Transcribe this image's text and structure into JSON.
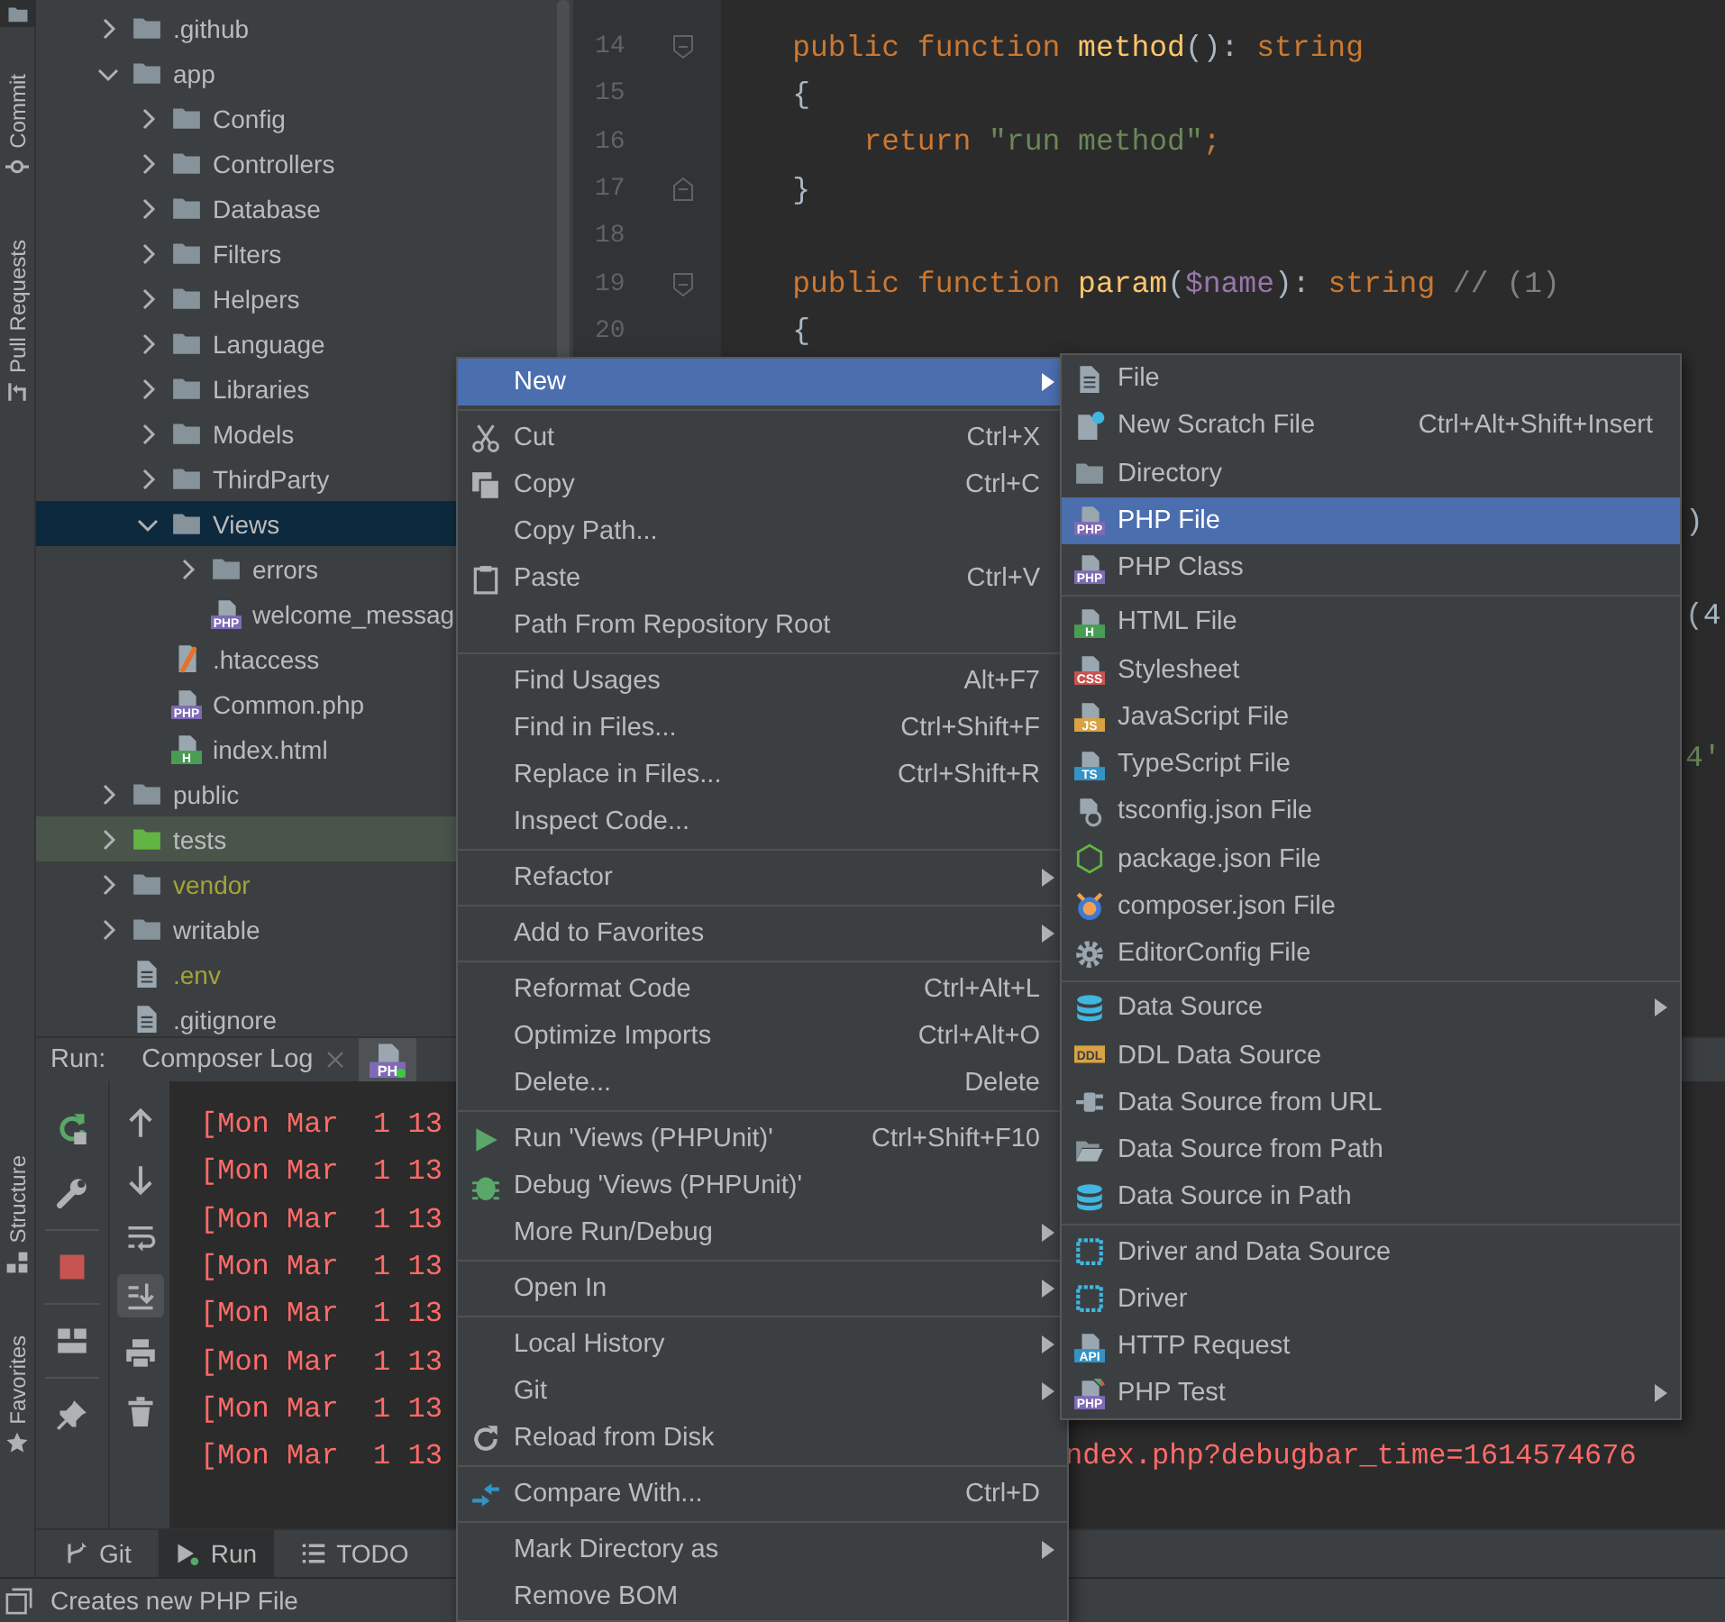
{
  "side_strip": {
    "project_button": {
      "selected": true
    },
    "top": [
      {
        "label": "Commit"
      },
      {
        "label": "Pull Requests"
      }
    ],
    "bottom": [
      {
        "label": "Structure"
      },
      {
        "label": "Favorites"
      }
    ]
  },
  "tree": [
    {
      "label": ".github",
      "kind": "folder",
      "expanded": false,
      "selected": false,
      "ignored": false
    },
    {
      "label": "app",
      "kind": "folder",
      "expanded": true,
      "selected": false,
      "ignored": false,
      "children": [
        {
          "label": "Config",
          "kind": "folder",
          "expanded": false,
          "selected": false,
          "ignored": false
        },
        {
          "label": "Controllers",
          "kind": "folder",
          "expanded": false,
          "selected": false,
          "ignored": false
        },
        {
          "label": "Database",
          "kind": "folder",
          "expanded": false,
          "selected": false,
          "ignored": false
        },
        {
          "label": "Filters",
          "kind": "folder",
          "expanded": false,
          "selected": false,
          "ignored": false
        },
        {
          "label": "Helpers",
          "kind": "folder",
          "expanded": false,
          "selected": false,
          "ignored": false
        },
        {
          "label": "Language",
          "kind": "folder",
          "expanded": false,
          "selected": false,
          "ignored": false
        },
        {
          "label": "Libraries",
          "kind": "folder",
          "expanded": false,
          "selected": false,
          "ignored": false
        },
        {
          "label": "Models",
          "kind": "folder",
          "expanded": false,
          "selected": false,
          "ignored": false
        },
        {
          "label": "ThirdParty",
          "kind": "folder",
          "expanded": false,
          "selected": false,
          "ignored": false
        },
        {
          "label": "Views",
          "kind": "folder",
          "expanded": true,
          "selected": true,
          "ignored": false,
          "children": [
            {
              "label": "errors",
              "kind": "folder",
              "expanded": false,
              "selected": false,
              "ignored": false
            },
            {
              "label": "welcome_messag",
              "kind": "php-file",
              "badge": "PHP",
              "selected": false,
              "ignored": false
            }
          ]
        },
        {
          "label": ".htaccess",
          "kind": "htaccess-file",
          "selected": false,
          "ignored": false
        },
        {
          "label": "Common.php",
          "kind": "php-file",
          "badge": "PHP",
          "selected": false,
          "ignored": false
        },
        {
          "label": "index.html",
          "kind": "html-file",
          "badge": "H",
          "selected": false,
          "ignored": false
        }
      ]
    },
    {
      "label": "public",
      "kind": "folder",
      "expanded": false,
      "selected": false,
      "ignored": false
    },
    {
      "label": "tests",
      "kind": "test-folder",
      "expanded": false,
      "selected": false,
      "ignored": false
    },
    {
      "label": "vendor",
      "kind": "folder",
      "expanded": false,
      "selected": false,
      "ignored": true
    },
    {
      "label": "writable",
      "kind": "folder",
      "expanded": false,
      "selected": false,
      "ignored": false
    },
    {
      "label": ".env",
      "kind": "file",
      "selected": false,
      "ignored": true
    },
    {
      "label": ".gitignore",
      "kind": "file",
      "selected": false,
      "ignored": false
    }
  ],
  "editor": {
    "lines": [
      {
        "number": "14",
        "kind": "block-start",
        "tokens": [
          {
            "text": "    public function ",
            "kind": "keyword"
          },
          {
            "text": "method",
            "kind": "function"
          },
          {
            "text": "(): ",
            "kind": "plain"
          },
          {
            "text": "string",
            "kind": "keyword"
          }
        ]
      },
      {
        "number": "15",
        "kind": "code",
        "tokens": [
          {
            "text": "    {",
            "kind": "plain"
          }
        ]
      },
      {
        "number": "16",
        "kind": "code",
        "tokens": [
          {
            "text": "        return ",
            "kind": "keyword"
          },
          {
            "text": "\"run method\"",
            "kind": "string"
          },
          {
            "text": ";",
            "kind": "keyword"
          }
        ]
      },
      {
        "number": "17",
        "kind": "block-end",
        "tokens": [
          {
            "text": "    }",
            "kind": "plain"
          }
        ]
      },
      {
        "number": "18",
        "kind": "code"
      },
      {
        "number": "19",
        "kind": "block-start",
        "tokens": [
          {
            "text": "    public function ",
            "kind": "keyword"
          },
          {
            "text": "param",
            "kind": "function"
          },
          {
            "text": "(",
            "kind": "plain"
          },
          {
            "text": "$name",
            "kind": "variable"
          },
          {
            "text": "): ",
            "kind": "plain"
          },
          {
            "text": "string",
            "kind": "keyword"
          },
          {
            "text": " // (1)",
            "kind": "comment"
          }
        ]
      },
      {
        "number": "20",
        "kind": "code",
        "tokens": [
          {
            "text": "    {",
            "kind": "plain"
          }
        ]
      }
    ],
    "edge_text": [
      [
        {
          "text": ")",
          "kind": "plain"
        }
      ],
      [
        {
          "text": "(4",
          "kind": "plain"
        }
      ],
      [
        {
          "text": "4'",
          "kind": "string"
        }
      ]
    ]
  },
  "run_panel": {
    "label": "Run:",
    "tabs": [
      {
        "kind": "log",
        "label": "Composer Log",
        "selected": false
      },
      {
        "kind": "php-run",
        "badge": "PH",
        "selected": true
      }
    ],
    "toolbar": [
      [
        {
          "kind": "rerun"
        },
        {
          "kind": "wrench"
        }
      ],
      [
        {
          "kind": "stop"
        }
      ],
      [
        {
          "kind": "layout"
        }
      ],
      [
        {
          "kind": "pin"
        }
      ]
    ],
    "toolbar2": [
      {
        "kind": "up",
        "selected": false
      },
      {
        "kind": "down",
        "selected": false
      },
      {
        "kind": "wrap",
        "selected": false
      },
      {
        "kind": "scroll-end",
        "selected": true
      },
      {
        "kind": "print",
        "selected": false
      },
      {
        "kind": "trash",
        "selected": false
      }
    ],
    "console": [
      {
        "text": "[Mon Mar  1 13"
      },
      {
        "text": "[Mon Mar  1 13"
      },
      {
        "text": "[Mon Mar  1 13"
      },
      {
        "text": "[Mon Mar  1 13"
      },
      {
        "text": "[Mon Mar  1 13"
      },
      {
        "text": "[Mon Mar  1 13"
      },
      {
        "text": "[Mon Mar  1 13"
      },
      {
        "text": "[Mon Mar  1 13",
        "tail": "ndex.php?debugbar_time=1614574676"
      }
    ]
  },
  "bottom_tabs": [
    {
      "label": "Git",
      "kind": "git",
      "selected": false
    },
    {
      "label": "Run",
      "kind": "run",
      "selected": true
    },
    {
      "label": "TODO",
      "kind": "list",
      "selected": false
    }
  ],
  "status_bar": {
    "text": "Creates new PHP File"
  },
  "context_menu": [
    [
      {
        "label": "New",
        "kind": "text",
        "submenu": true,
        "selected": true
      }
    ],
    [
      {
        "label": "Cut",
        "kind": "scissors",
        "shortcut": "Ctrl+X",
        "submenu": false,
        "selected": false
      },
      {
        "label": "Copy",
        "kind": "copy",
        "shortcut": "Ctrl+C",
        "submenu": false,
        "selected": false
      },
      {
        "label": "Copy Path...",
        "kind": "text",
        "submenu": false,
        "selected": false
      },
      {
        "label": "Paste",
        "kind": "clipboard",
        "shortcut": "Ctrl+V",
        "submenu": false,
        "selected": false
      },
      {
        "label": "Path From Repository Root",
        "kind": "text",
        "submenu": false,
        "selected": false
      }
    ],
    [
      {
        "label": "Find Usages",
        "kind": "text",
        "shortcut": "Alt+F7",
        "submenu": false,
        "selected": false
      },
      {
        "label": "Find in Files...",
        "kind": "text",
        "shortcut": "Ctrl+Shift+F",
        "submenu": false,
        "selected": false
      },
      {
        "label": "Replace in Files...",
        "kind": "text",
        "shortcut": "Ctrl+Shift+R",
        "submenu": false,
        "selected": false
      },
      {
        "label": "Inspect Code...",
        "kind": "text",
        "submenu": false,
        "selected": false
      }
    ],
    [
      {
        "label": "Refactor",
        "kind": "text",
        "submenu": true,
        "selected": false
      }
    ],
    [
      {
        "label": "Add to Favorites",
        "kind": "text",
        "submenu": true,
        "selected": false
      }
    ],
    [
      {
        "label": "Reformat Code",
        "kind": "text",
        "shortcut": "Ctrl+Alt+L",
        "submenu": false,
        "selected": false
      },
      {
        "label": "Optimize Imports",
        "kind": "text",
        "shortcut": "Ctrl+Alt+O",
        "submenu": false,
        "selected": false
      },
      {
        "label": "Delete...",
        "kind": "text",
        "shortcut": "Delete",
        "submenu": false,
        "selected": false
      }
    ],
    [
      {
        "label": "Run 'Views (PHPUnit)'",
        "kind": "play",
        "shortcut": "Ctrl+Shift+F10",
        "submenu": false,
        "selected": false
      },
      {
        "label": "Debug 'Views (PHPUnit)'",
        "kind": "bug",
        "submenu": false,
        "selected": false
      },
      {
        "label": "More Run/Debug",
        "kind": "text",
        "submenu": true,
        "selected": false
      }
    ],
    [
      {
        "label": "Open In",
        "kind": "text",
        "submenu": true,
        "selected": false
      }
    ],
    [
      {
        "label": "Local History",
        "kind": "text",
        "submenu": true,
        "selected": false
      },
      {
        "label": "Git",
        "kind": "text",
        "submenu": true,
        "selected": false
      },
      {
        "label": "Reload from Disk",
        "kind": "reload",
        "submenu": false,
        "selected": false
      }
    ],
    [
      {
        "label": "Compare With...",
        "kind": "compare",
        "shortcut": "Ctrl+D",
        "submenu": false,
        "selected": false
      }
    ],
    [
      {
        "label": "Mark Directory as",
        "kind": "text",
        "submenu": true,
        "selected": false
      },
      {
        "label": "Remove BOM",
        "kind": "text",
        "submenu": false,
        "selected": false
      }
    ]
  ],
  "new_submenu": [
    [
      {
        "label": "File",
        "kind": "file",
        "submenu": false,
        "selected": false
      },
      {
        "label": "New Scratch File",
        "kind": "scratch",
        "shortcut": "Ctrl+Alt+Shift+Insert",
        "submenu": false,
        "selected": false
      },
      {
        "label": "Directory",
        "kind": "folder",
        "submenu": false,
        "selected": false
      },
      {
        "label": "PHP File",
        "kind": "php",
        "badge": "PHP",
        "submenu": false,
        "selected": true
      },
      {
        "label": "PHP Class",
        "kind": "php",
        "badge": "PHP",
        "submenu": false,
        "selected": false
      }
    ],
    [
      {
        "label": "HTML File",
        "kind": "html",
        "badge": "H",
        "submenu": false,
        "selected": false
      },
      {
        "label": "Stylesheet",
        "kind": "css",
        "badge": "CSS",
        "submenu": false,
        "selected": false
      },
      {
        "label": "JavaScript File",
        "kind": "js",
        "badge": "JS",
        "submenu": false,
        "selected": false
      },
      {
        "label": "TypeScript File",
        "kind": "ts",
        "badge": "TS",
        "submenu": false,
        "selected": false
      },
      {
        "label": "tsconfig.json File",
        "kind": "tsconfig",
        "submenu": false,
        "selected": false
      },
      {
        "label": "package.json File",
        "kind": "nodejs",
        "submenu": false,
        "selected": false
      },
      {
        "label": "composer.json File",
        "kind": "composer",
        "submenu": false,
        "selected": false
      },
      {
        "label": "EditorConfig File",
        "kind": "gear",
        "submenu": false,
        "selected": false
      }
    ],
    [
      {
        "label": "Data Source",
        "kind": "database",
        "submenu": true,
        "selected": false
      },
      {
        "label": "DDL Data Source",
        "kind": "ddl",
        "badge": "DDL",
        "submenu": false,
        "selected": false
      },
      {
        "label": "Data Source from URL",
        "kind": "plug",
        "submenu": false,
        "selected": false
      },
      {
        "label": "Data Source from Path",
        "kind": "folder-open",
        "submenu": false,
        "selected": false
      },
      {
        "label": "Data Source in Path",
        "kind": "database",
        "submenu": false,
        "selected": false
      }
    ],
    [
      {
        "label": "Driver and Data Source",
        "kind": "driver",
        "submenu": false,
        "selected": false
      },
      {
        "label": "Driver",
        "kind": "driver",
        "submenu": false,
        "selected": false
      },
      {
        "label": "HTTP Request",
        "kind": "api",
        "badge": "API",
        "submenu": false,
        "selected": false
      },
      {
        "label": "PHP Test",
        "kind": "php-test",
        "badge": "PHP",
        "submenu": true,
        "selected": false
      }
    ]
  ]
}
